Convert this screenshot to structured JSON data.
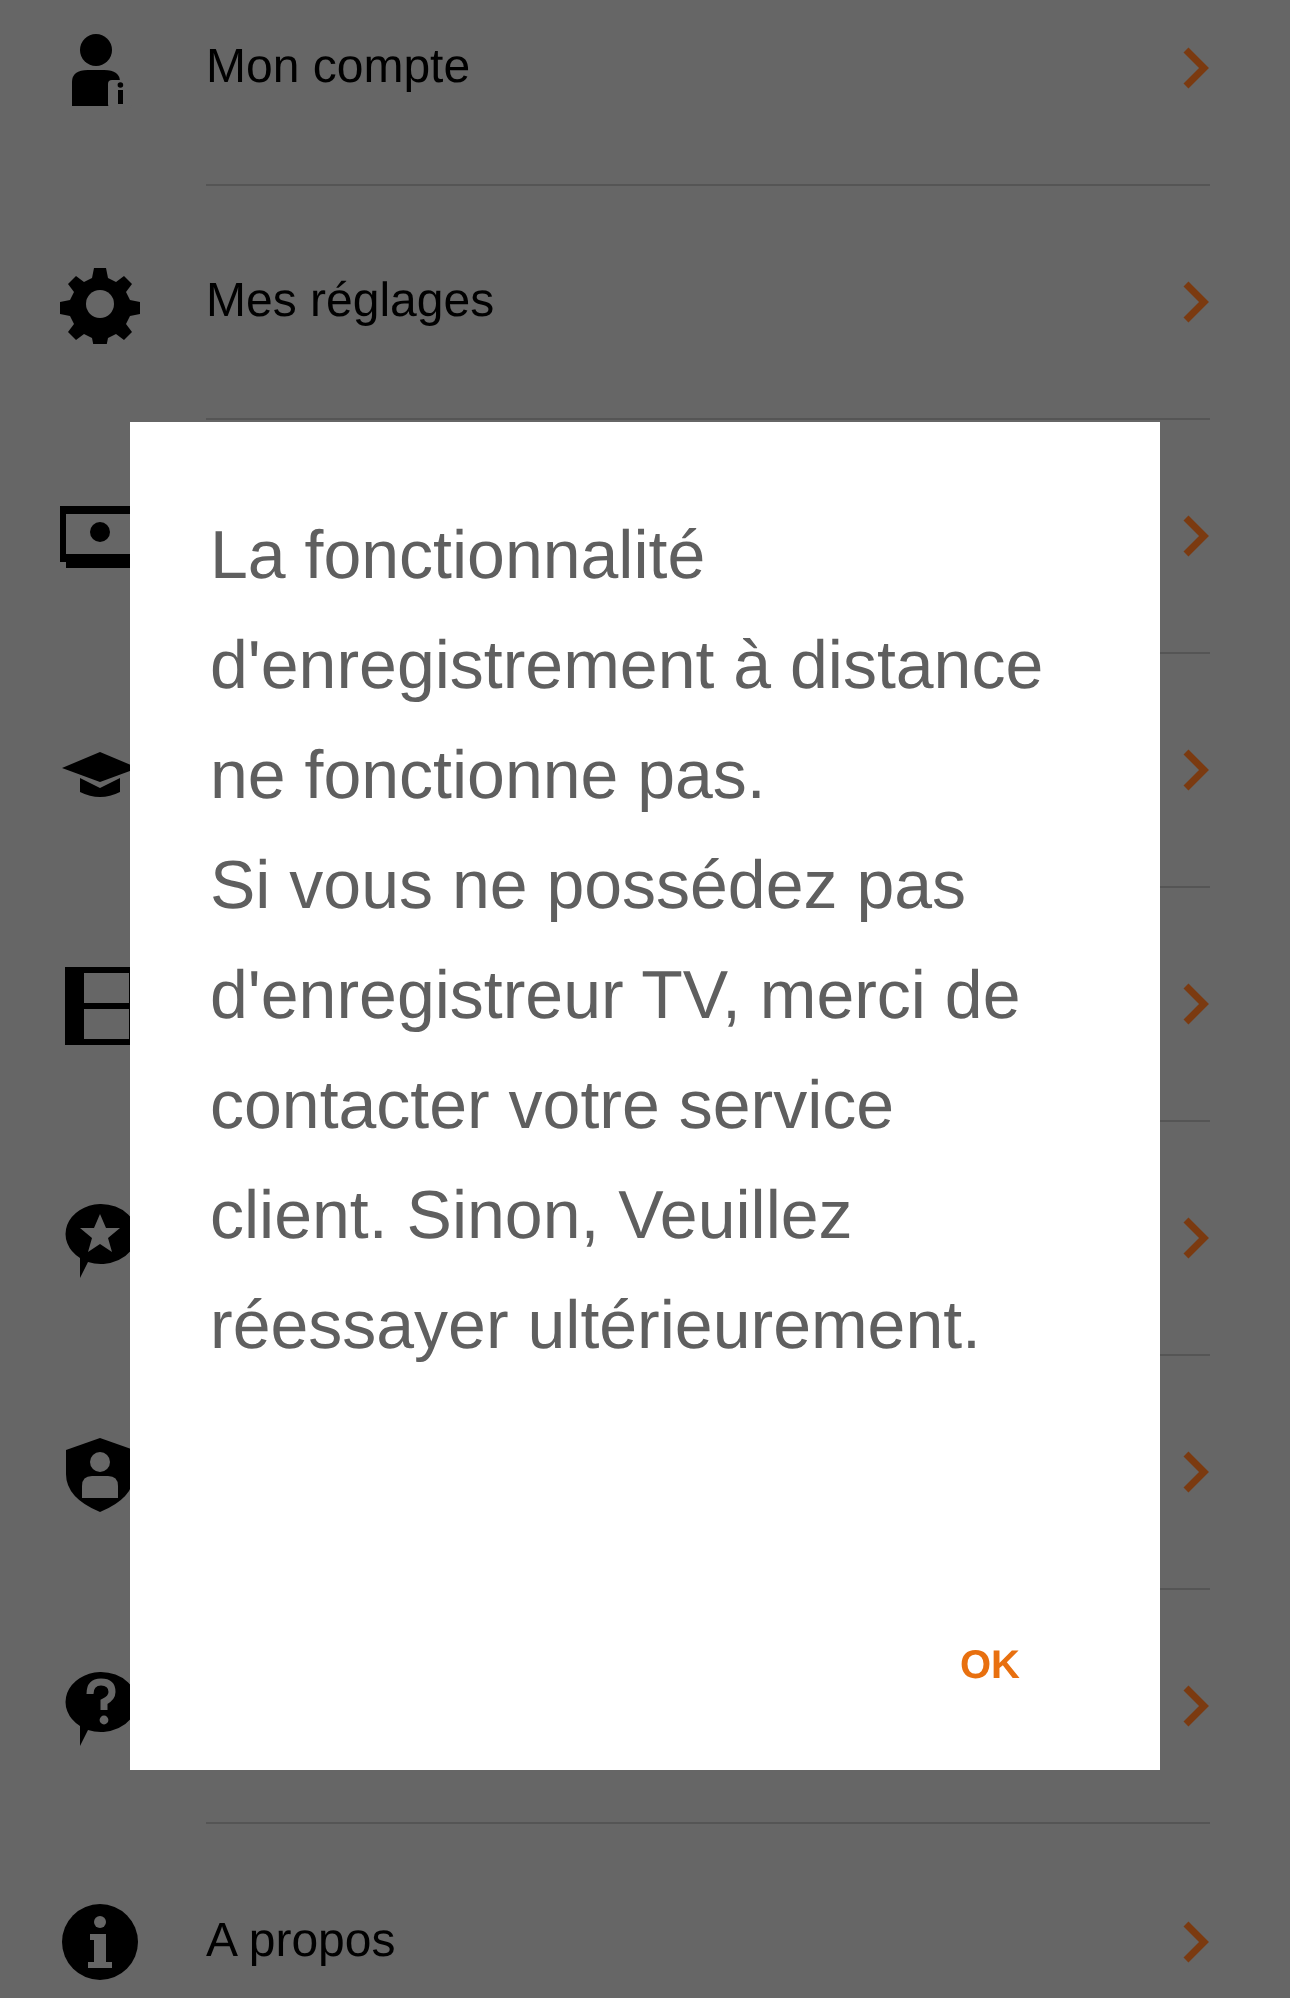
{
  "menu": {
    "items": [
      {
        "label": "Mon compte",
        "kind": "account"
      },
      {
        "label": "Mes réglages",
        "kind": "settings"
      },
      {
        "kind": "tv"
      },
      {
        "kind": "cap"
      },
      {
        "kind": "film"
      },
      {
        "kind": "star"
      },
      {
        "kind": "shield"
      },
      {
        "kind": "help"
      },
      {
        "label": "A propos",
        "kind": "info"
      }
    ]
  },
  "dialog": {
    "paragraphs": [
      "La fonctionnalité d'enregistrement à distance ne fonctionne pas.",
      "Si vous ne possédez pas d'enregistreur TV, merci de contacter votre service client. Sinon, Veuillez réessayer ultérieurement."
    ],
    "button": "OK"
  }
}
